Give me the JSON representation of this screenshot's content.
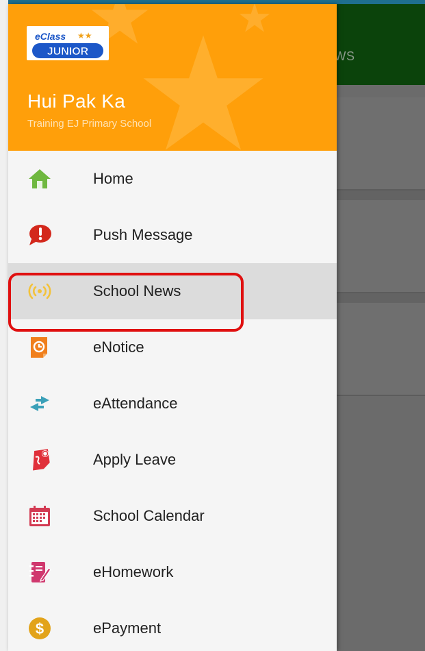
{
  "background_app": {
    "tab_label": "EWS"
  },
  "drawer": {
    "logo_text": "eClass JUNIOR",
    "user_name": "Hui Pak Ka",
    "school_name": "Training EJ Primary School",
    "header_color": "#ff9f0a"
  },
  "menu": {
    "items": [
      {
        "label": "Home",
        "icon": "home-icon",
        "color": "#6fb83f"
      },
      {
        "label": "Push Message",
        "icon": "alert-bubble-icon",
        "color": "#d3281c"
      },
      {
        "label": "School News",
        "icon": "broadcast-icon",
        "color": "#f3c23a",
        "active": true
      },
      {
        "label": "eNotice",
        "icon": "notice-icon",
        "color": "#f07f1c"
      },
      {
        "label": "eAttendance",
        "icon": "swap-arrows-icon",
        "color": "#3aa0b8"
      },
      {
        "label": "Apply Leave",
        "icon": "leave-icon",
        "color": "#e0303a"
      },
      {
        "label": "School Calendar",
        "icon": "calendar-icon",
        "color": "#d23a52"
      },
      {
        "label": "eHomework",
        "icon": "homework-icon",
        "color": "#d0386e"
      },
      {
        "label": "ePayment",
        "icon": "dollar-icon",
        "color": "#e2a31a"
      }
    ]
  },
  "annotation": {
    "highlight_color": "#e01010"
  }
}
